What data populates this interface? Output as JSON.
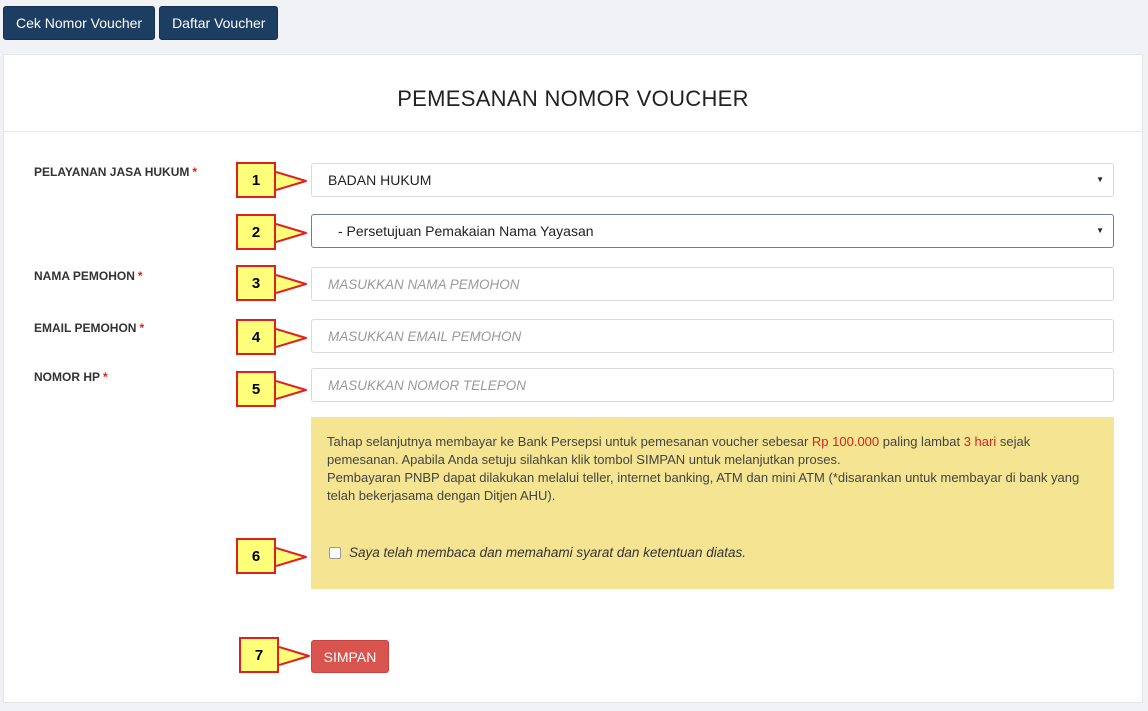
{
  "nav": {
    "cek_label": "Cek Nomor Voucher",
    "daftar_label": "Daftar Voucher"
  },
  "page_title": "PEMESANAN NOMOR VOUCHER",
  "form": {
    "layanan": {
      "label": "PELAYANAN JASA HUKUM",
      "required_mark": "*",
      "value": "BADAN HUKUM"
    },
    "jenis": {
      "value": "- Persetujuan Pemakaian Nama Yayasan"
    },
    "nama": {
      "label": "NAMA PEMOHON",
      "required_mark": "*",
      "placeholder": "MASUKKAN NAMA PEMOHON"
    },
    "email": {
      "label": "EMAIL PEMOHON",
      "required_mark": "*",
      "placeholder": "MASUKKAN EMAIL PEMOHON"
    },
    "hp": {
      "label": "NOMOR HP",
      "required_mark": "*",
      "placeholder": "MASUKKAN NOMOR TELEPON"
    }
  },
  "notice": {
    "p1_a": "Tahap selanjutnya membayar ke Bank Persepsi untuk pemesanan voucher sebesar ",
    "amount": "Rp 100.000",
    "p1_b": " paling lambat ",
    "deadline": "3 hari",
    "p1_c": " sejak pemesanan. Apabila Anda setuju silahkan klik tombol SIMPAN untuk melanjutkan proses.",
    "p2": "Pembayaran PNBP dapat dilakukan melalui teller, internet banking, ATM dan mini ATM (*disarankan untuk membayar di bank yang telah bekerjasama dengan Ditjen AHU).",
    "agree_label": "Saya telah membaca dan memahami syarat dan ketentuan diatas."
  },
  "submit_label": "SIMPAN",
  "markers": [
    "1",
    "2",
    "3",
    "4",
    "5",
    "6",
    "7"
  ],
  "colors": {
    "nav_button": "#1d3e63",
    "required": "#d9231d",
    "notice_bg": "#f5e491",
    "submit_button": "#d9534f",
    "marker_fill": "#ffff7a",
    "marker_border": "#e02020"
  }
}
